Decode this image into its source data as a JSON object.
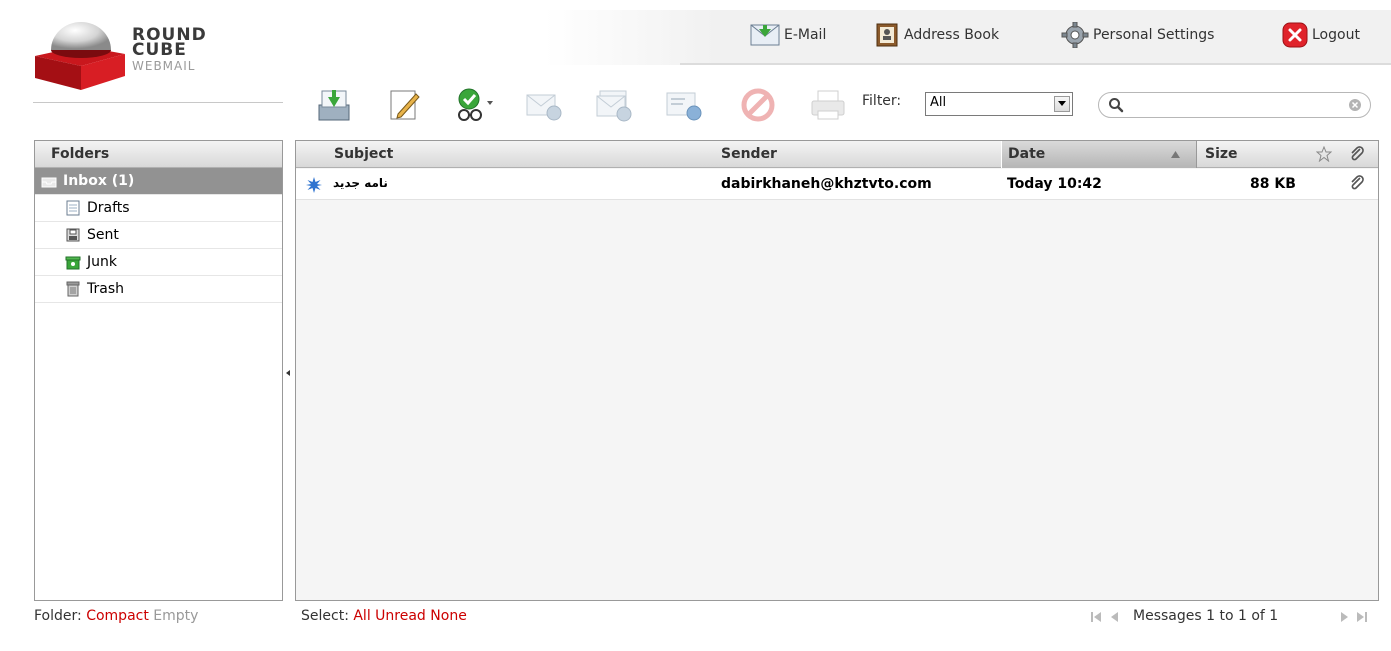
{
  "logo": {
    "line1": "ROUND",
    "line2": "CUBE",
    "line3": "WEBMAIL"
  },
  "topnav": {
    "email": {
      "label": "E-Mail",
      "icon": "email-icon"
    },
    "addressbook": {
      "label": "Address Book",
      "icon": "address-book-icon"
    },
    "settings": {
      "label": "Personal Settings",
      "icon": "gear-icon"
    },
    "logout": {
      "label": "Logout",
      "icon": "logout-icon"
    }
  },
  "toolbar": {
    "buttons": [
      {
        "name": "check-mail-icon",
        "enabled": true
      },
      {
        "name": "compose-icon",
        "enabled": true
      },
      {
        "name": "mark-message-icon",
        "enabled": true
      },
      {
        "name": "reply-icon",
        "enabled": false
      },
      {
        "name": "reply-all-icon",
        "enabled": false
      },
      {
        "name": "forward-icon",
        "enabled": false
      },
      {
        "name": "delete-icon",
        "enabled": false
      },
      {
        "name": "print-icon",
        "enabled": false
      }
    ],
    "filter_label": "Filter:",
    "filter_value": "All",
    "search_value": ""
  },
  "folders": {
    "header": "Folders",
    "items": [
      {
        "label": "Inbox (1)",
        "selected": true
      },
      {
        "label": "Drafts"
      },
      {
        "label": "Sent"
      },
      {
        "label": "Junk"
      },
      {
        "label": "Trash"
      }
    ]
  },
  "list": {
    "columns": {
      "subject": "Subject",
      "sender": "Sender",
      "date": "Date",
      "size": "Size"
    },
    "messages": [
      {
        "subject": "نامه جدید",
        "sender": "dabirkhaneh@khztvto.com",
        "date": "Today 10:42",
        "size": "88 KB",
        "unread": true,
        "attachment": true
      }
    ]
  },
  "footer": {
    "folder_label": "Folder:",
    "compact": "Compact",
    "empty": "Empty",
    "select_label": "Select:",
    "all": "All",
    "unread": "Unread",
    "none": "None",
    "count": "Messages 1 to 1 of 1"
  },
  "colors": {
    "accent": "#cc0000",
    "selected": "#929292",
    "header_grad_top": "#f4f4f4",
    "header_grad_bottom": "#d8d8d8"
  }
}
